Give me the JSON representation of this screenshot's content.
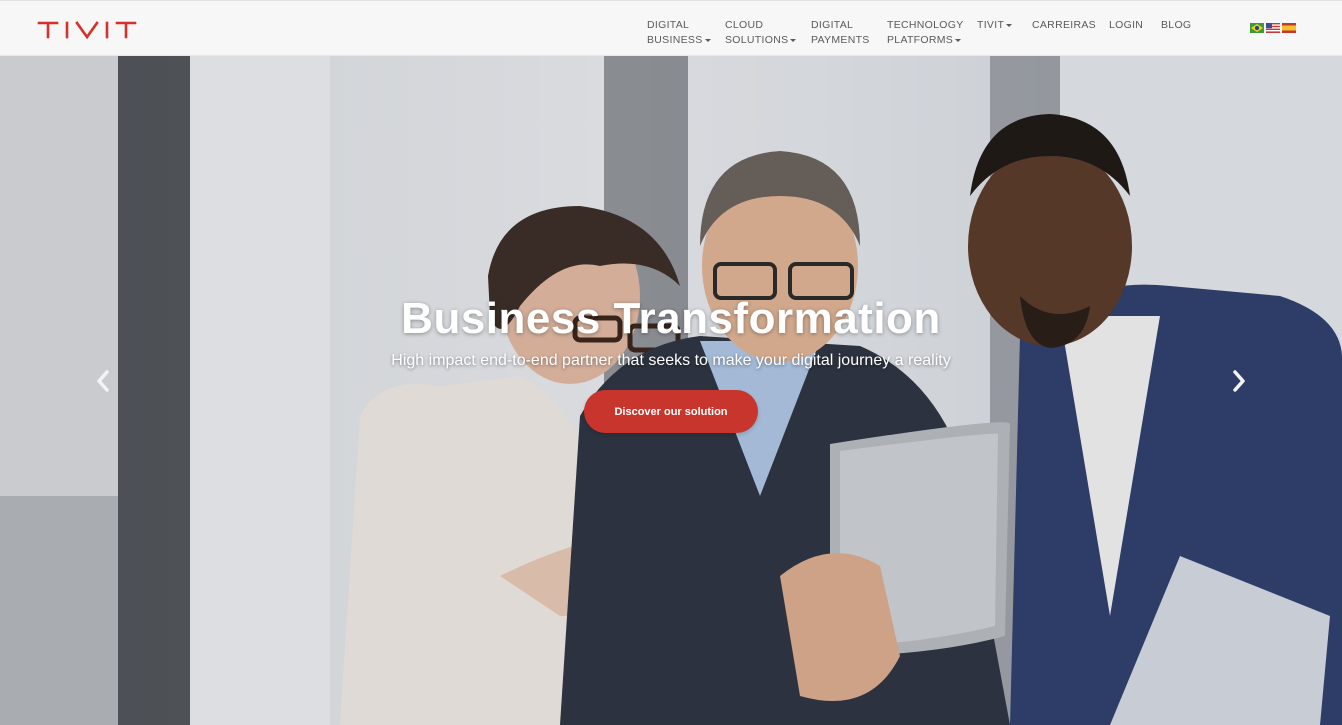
{
  "brand": {
    "name": "TIVIT",
    "color": "#d6302a"
  },
  "nav": {
    "items": [
      {
        "line1": "DIGITAL",
        "line2": "BUSINESS",
        "dropdown": true
      },
      {
        "line1": "CLOUD",
        "line2": "SOLUTIONS",
        "dropdown": true
      },
      {
        "line1": "DIGITAL",
        "line2": "PAYMENTS",
        "dropdown": false
      },
      {
        "line1": "TECHNOLOGY",
        "line2": "PLATFORMS",
        "dropdown": true
      },
      {
        "line1": "TIVIT",
        "line2": "",
        "dropdown": true
      },
      {
        "line1": "CARREIRAS",
        "line2": "",
        "dropdown": false
      },
      {
        "line1": "LOGIN",
        "line2": "",
        "dropdown": false
      },
      {
        "line1": "BLOG",
        "line2": "",
        "dropdown": false
      }
    ],
    "languages": [
      "brazil-flag-icon",
      "usa-flag-icon",
      "spain-flag-icon"
    ]
  },
  "hero": {
    "title": "Business Transformation",
    "subtitle": "High impact end-to-end partner that seeks to make your digital journey a reality",
    "cta_label": "Discover our solution",
    "cta_color": "#c8352d",
    "prev_icon": "chevron-left-icon",
    "next_icon": "chevron-right-icon"
  }
}
